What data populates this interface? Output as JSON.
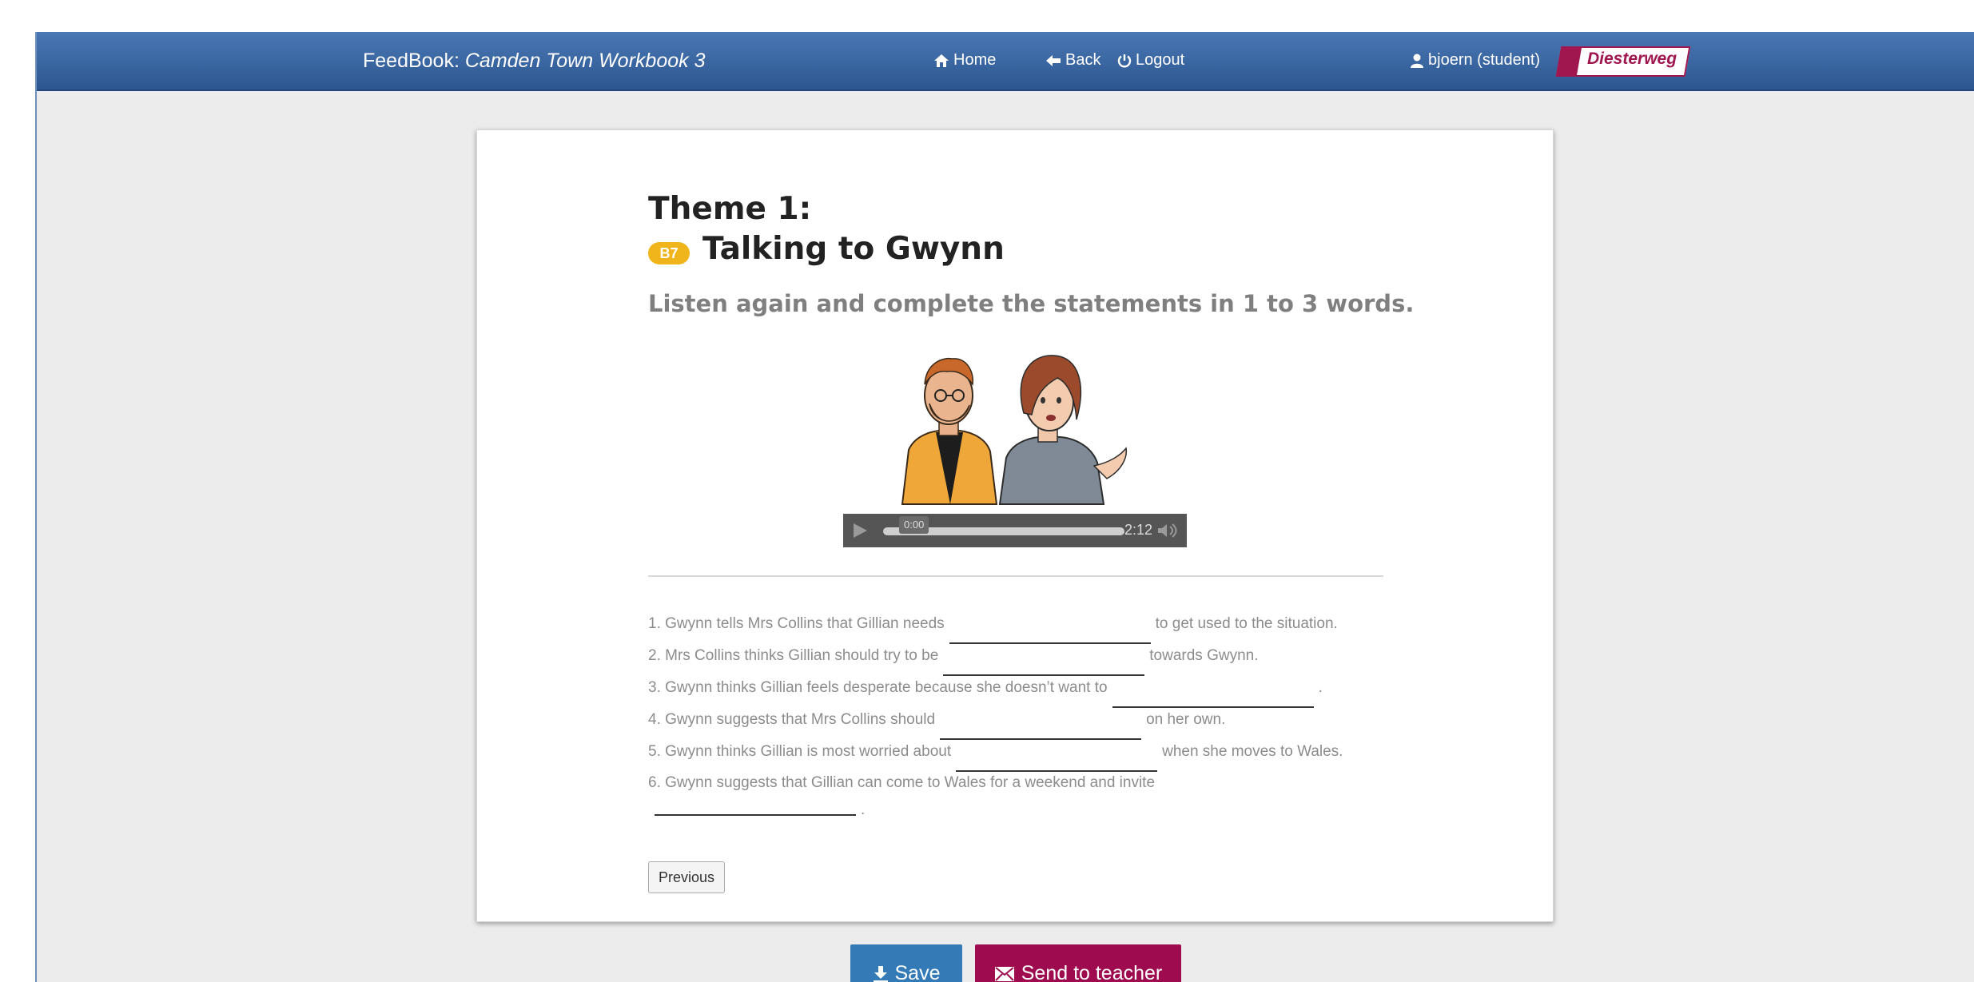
{
  "navbar": {
    "brand_prefix": "FeedBook: ",
    "brand_book": "Camden Town Workbook 3",
    "home": "Home",
    "back": "Back",
    "logout": "Logout",
    "user": "bjoern (student)",
    "publisher_logo": "Diesterweg",
    "background_color": "#3a67a3"
  },
  "exercise": {
    "theme": "Theme 1:",
    "badge": "B7",
    "title": "Talking to Gwynn",
    "instruction": "Listen again and complete the statements in 1 to 3 words.",
    "illustration": "two-cartoon-characters",
    "audio": {
      "current_time": "0:00",
      "duration": "2:12",
      "progress": 0
    },
    "statements": [
      {
        "before": "1. Gwynn tells Mrs Collins that Gillian needs",
        "after": "to get used to the situation.",
        "answer": ""
      },
      {
        "before": "2. Mrs Collins thinks Gillian should try to be",
        "after": "towards Gwynn.",
        "answer": ""
      },
      {
        "before": "3. Gwynn thinks Gillian feels desperate because she doesn’t want to",
        "after": ".",
        "answer": ""
      },
      {
        "before": "4. Gwynn suggests that Mrs Collins should",
        "after": "on her own.",
        "answer": ""
      },
      {
        "before": "5. Gwynn thinks Gillian is most worried about",
        "after": "when she moves to Wales.",
        "answer": ""
      },
      {
        "before": "6. Gwynn suggests that Gillian can come to Wales for a weekend and invite",
        "after": ".",
        "answer": ""
      }
    ],
    "previous_label": "Previous"
  },
  "actions": {
    "save_label": "Save",
    "send_label": "Send to teacher",
    "save_color": "#337ab7",
    "send_color": "#9e0b4e"
  },
  "icons": {
    "home": "home-icon",
    "back": "arrow-left-icon",
    "logout": "power-icon",
    "user": "user-icon",
    "play": "play-icon",
    "volume": "volume-icon",
    "save": "download-icon",
    "send": "envelope-icon"
  }
}
